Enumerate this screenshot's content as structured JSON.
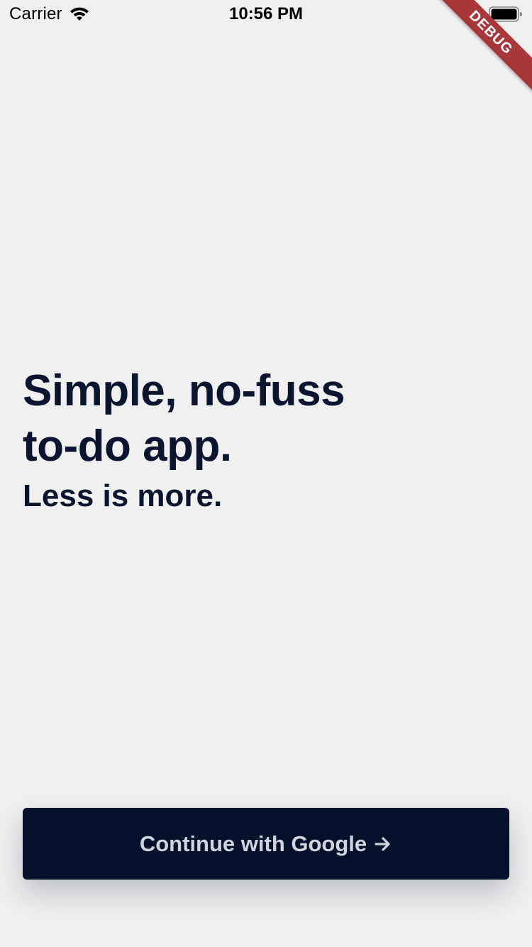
{
  "status_bar": {
    "carrier": "Carrier",
    "time": "10:56 PM",
    "wifi_icon": "wifi-icon",
    "battery_icon": "battery-icon"
  },
  "debug_banner": {
    "label": "DEBUG",
    "color": "#a8373a"
  },
  "hero": {
    "headline_line1": "Simple, no-fuss",
    "headline_line2": "to-do app.",
    "tagline": "Less is more."
  },
  "cta": {
    "label": "Continue with Google",
    "icon": "arrow-right-icon",
    "background": "#03112b",
    "text_color": "#cfd3dc"
  },
  "colors": {
    "background": "#f0f0f1",
    "text_primary": "#0b1530"
  }
}
